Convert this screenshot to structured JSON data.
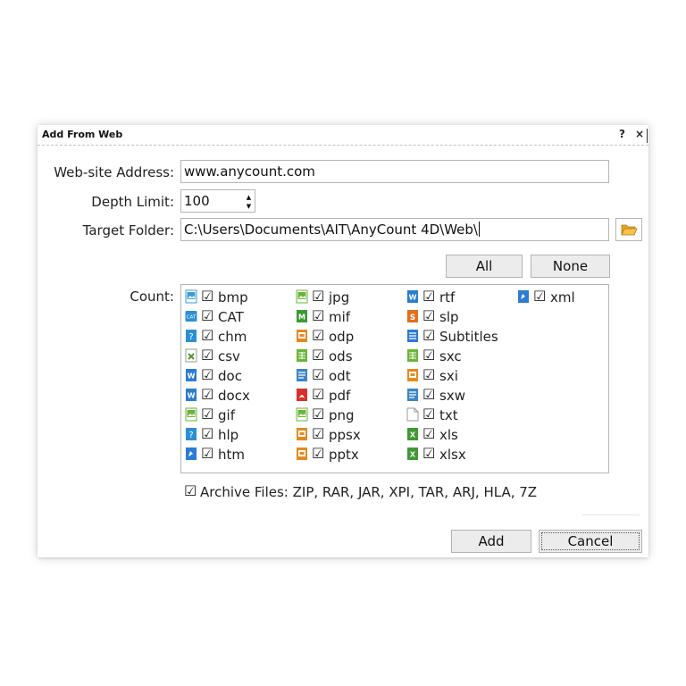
{
  "dialog": {
    "title": "Add From Web",
    "help_glyph": "?",
    "close_glyph": "×"
  },
  "form": {
    "website_label": "Web-site Address:",
    "website_value": "www.anycount.com",
    "depth_label": "Depth Limit:",
    "depth_value": "100",
    "folder_label": "Target Folder:",
    "folder_value": "C:\\Users\\Documents\\AIT\\AnyCount 4D\\Web\\",
    "browse_icon": "folder-open-icon"
  },
  "selection": {
    "all_label": "All",
    "none_label": "None"
  },
  "count": {
    "label": "Count:",
    "check_glyph": "☑",
    "columns": [
      [
        {
          "name": "bmp",
          "icon": "image",
          "color": "#3a9bd9",
          "checked": true
        },
        {
          "name": "CAT",
          "icon": "cat",
          "color": "#2b8fd6",
          "checked": true
        },
        {
          "name": "chm",
          "icon": "help",
          "color": "#2b8fd6",
          "checked": true
        },
        {
          "name": "csv",
          "icon": "csv",
          "color": "#4c9a2a",
          "checked": true
        },
        {
          "name": "doc",
          "icon": "word",
          "color": "#2b7cd3",
          "checked": true
        },
        {
          "name": "docx",
          "icon": "word",
          "color": "#2b7cd3",
          "checked": true
        },
        {
          "name": "gif",
          "icon": "image",
          "color": "#6ab536",
          "checked": true
        },
        {
          "name": "hlp",
          "icon": "help",
          "color": "#2b8fd6",
          "checked": true
        },
        {
          "name": "htm",
          "icon": "web",
          "color": "#2b7cd3",
          "checked": true
        }
      ],
      [
        {
          "name": "jpg",
          "icon": "image",
          "color": "#6ab536",
          "checked": true
        },
        {
          "name": "mif",
          "icon": "mif",
          "color": "#3c9a34",
          "checked": true
        },
        {
          "name": "odp",
          "icon": "slides",
          "color": "#e58a1f",
          "checked": true
        },
        {
          "name": "ods",
          "icon": "sheet",
          "color": "#6ab536",
          "checked": true
        },
        {
          "name": "odt",
          "icon": "text",
          "color": "#3a86c8",
          "checked": true
        },
        {
          "name": "pdf",
          "icon": "pdf",
          "color": "#d9302c",
          "checked": true
        },
        {
          "name": "png",
          "icon": "image",
          "color": "#6ab536",
          "checked": true
        },
        {
          "name": "ppsx",
          "icon": "slides",
          "color": "#e58a1f",
          "checked": true
        },
        {
          "name": "pptx",
          "icon": "slides",
          "color": "#e58a1f",
          "checked": true
        }
      ],
      [
        {
          "name": "rtf",
          "icon": "word",
          "color": "#2b7cd3",
          "checked": true
        },
        {
          "name": "slp",
          "icon": "slp",
          "color": "#e0701e",
          "checked": true
        },
        {
          "name": "Subtitles",
          "icon": "doc",
          "color": "#2b7cd3",
          "checked": true
        },
        {
          "name": "sxc",
          "icon": "sheet",
          "color": "#6ab536",
          "checked": true
        },
        {
          "name": "sxi",
          "icon": "slides",
          "color": "#e58a1f",
          "checked": true
        },
        {
          "name": "sxw",
          "icon": "text",
          "color": "#3a86c8",
          "checked": true
        },
        {
          "name": "txt",
          "icon": "blank",
          "color": "#9a9a9a",
          "checked": true
        },
        {
          "name": "xls",
          "icon": "excel",
          "color": "#3f9a34",
          "checked": true
        },
        {
          "name": "xlsx",
          "icon": "excel",
          "color": "#3f9a34",
          "checked": true
        }
      ],
      [
        {
          "name": "xml",
          "icon": "web",
          "color": "#2b7cd3",
          "checked": true
        }
      ]
    ]
  },
  "archive": {
    "label": "Archive Files: ZIP, RAR, JAR, XPI, TAR, ARJ, HLA, 7Z",
    "checked": true
  },
  "buttons": {
    "add_label": "Add",
    "cancel_label": "Cancel"
  }
}
